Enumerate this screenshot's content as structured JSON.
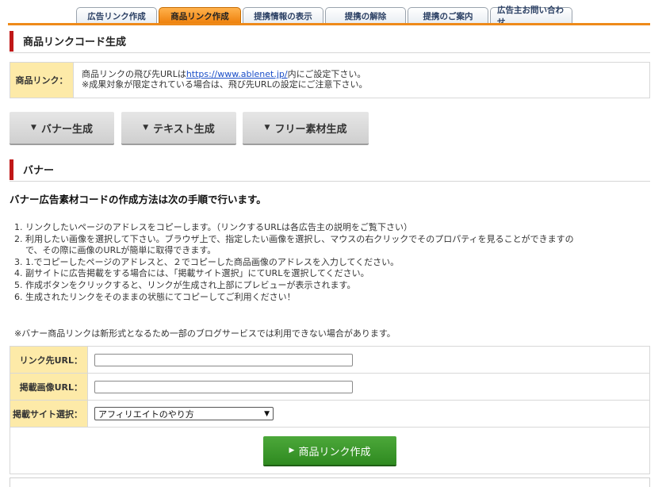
{
  "tabs": [
    {
      "label": "広告リンク作成"
    },
    {
      "label": "商品リンク作成"
    },
    {
      "label": "提携情報の表示"
    },
    {
      "label": "提携の解除"
    },
    {
      "label": "提携のご案内"
    },
    {
      "label": "広告主お問い合わせ"
    }
  ],
  "section1": {
    "title": "商品リンクコード生成"
  },
  "info": {
    "label": "商品リンク：",
    "line1_prefix": "商品リンクの飛び先URLは",
    "line1_link": "https://www.ablenet.jp/",
    "line1_suffix": "内にご設定下さい。",
    "line2": "※成果対象が限定されている場合は、飛び先URLの設定にご注意下さい。"
  },
  "buttons": {
    "banner": "バナー生成",
    "text": "テキスト生成",
    "free": "フリー素材生成",
    "arrow": "▼"
  },
  "section2": {
    "title": "バナー"
  },
  "lead": "バナー広告素材コードの作成方法は次の手順で行います。",
  "steps": [
    {
      "n": "1.",
      "text": "リンクしたいページのアドレスをコピーします。（リンクするURLは各広告主の説明をご覧下さい）"
    },
    {
      "n": "2.",
      "text": "利用したい画像を選択して下さい。ブラウザ上で、指定したい画像を選択し、マウスの右クリックでそのプロパティを見ることができますの",
      "cont": "で、その際に画像のURLが簡単に取得できます。"
    },
    {
      "n": "3.",
      "text": "1.でコピーしたページのアドレスと、２でコピーした商品画像のアドレスを入力してください。"
    },
    {
      "n": "4.",
      "text": "副サイトに広告掲載をする場合には、「掲載サイト選択」にてURLを選択してください。"
    },
    {
      "n": "5.",
      "text": "作成ボタンをクリックすると、リンクが生成され上部にプレビューが表示されます。"
    },
    {
      "n": "6.",
      "text": "生成されたリンクをそのままの状態にてコピーしてご利用ください！"
    }
  ],
  "note": "※バナー商品リンクは新形式となるため一部のブログサービスでは利用できない場合があります。",
  "form": {
    "link_url_label": "リンク先URL：",
    "link_url_value": "",
    "image_url_label": "掲載画像URL：",
    "image_url_value": "",
    "site_label": "掲載サイト選択：",
    "site_selected": "アフィリエイトのやり方",
    "submit_label": "商品リンク作成",
    "submit_arrow": "▶"
  }
}
